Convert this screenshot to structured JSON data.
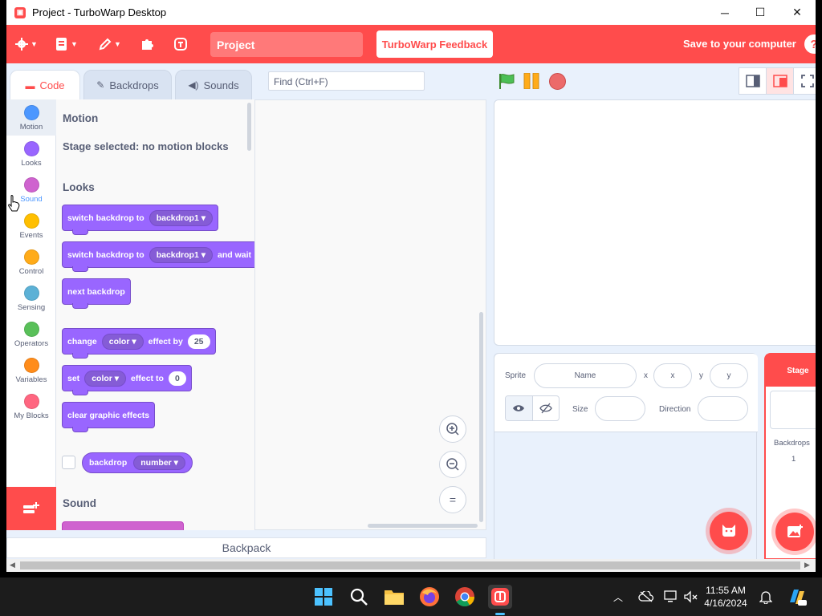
{
  "window": {
    "title": "Project - TurboWarp Desktop",
    "minimize": "─",
    "maximize": "☐",
    "close": "✕"
  },
  "menubar": {
    "project_title": "Project",
    "feedback": "TurboWarp Feedback",
    "save": "Save to your computer",
    "help": "?"
  },
  "tabs": [
    {
      "label": "Code"
    },
    {
      "label": "Backdrops"
    },
    {
      "label": "Sounds"
    }
  ],
  "find_placeholder": "Find (Ctrl+F)",
  "categories": [
    {
      "label": "Motion",
      "color": "#4c97ff"
    },
    {
      "label": "Looks",
      "color": "#9966ff"
    },
    {
      "label": "Sound",
      "color": "#cf63cf"
    },
    {
      "label": "Events",
      "color": "#ffbf00"
    },
    {
      "label": "Control",
      "color": "#ffab19"
    },
    {
      "label": "Sensing",
      "color": "#5cb1d6"
    },
    {
      "label": "Operators",
      "color": "#59c059"
    },
    {
      "label": "Variables",
      "color": "#ff8c1a"
    },
    {
      "label": "My Blocks",
      "color": "#ff6680"
    }
  ],
  "palette": {
    "motion_header": "Motion",
    "motion_note": "Stage selected: no motion blocks",
    "looks_header": "Looks",
    "sound_header": "Sound",
    "blocks": {
      "b1_text": "switch backdrop to",
      "b1_dd": "backdrop1 ▾",
      "b2_text": "switch backdrop to",
      "b2_dd": "backdrop1 ▾",
      "b2_tail": "and wait",
      "b3_text": "next backdrop",
      "b4_text": "change",
      "b4_dd": "color ▾",
      "b4_mid": "effect by",
      "b4_num": "25",
      "b5_text": "set",
      "b5_dd": "color ▾",
      "b5_mid": "effect to",
      "b5_num": "0",
      "b6_text": "clear graphic effects",
      "r1_text": "backdrop",
      "r1_dd": "number ▾"
    }
  },
  "zoom": {
    "in": "+",
    "out": "−",
    "reset": "="
  },
  "backpack": "Backpack",
  "sprite_info": {
    "sprite_label": "Sprite",
    "name_placeholder": "Name",
    "x_label": "x",
    "x_placeholder": "x",
    "y_label": "y",
    "y_placeholder": "y",
    "size_label": "Size",
    "direction_label": "Direction"
  },
  "stage_pane": {
    "tab": "Stage",
    "backdrops_label": "Backdrops",
    "backdrops_count": "1"
  },
  "taskbar": {
    "time": "11:55 AM",
    "date": "4/16/2024"
  }
}
